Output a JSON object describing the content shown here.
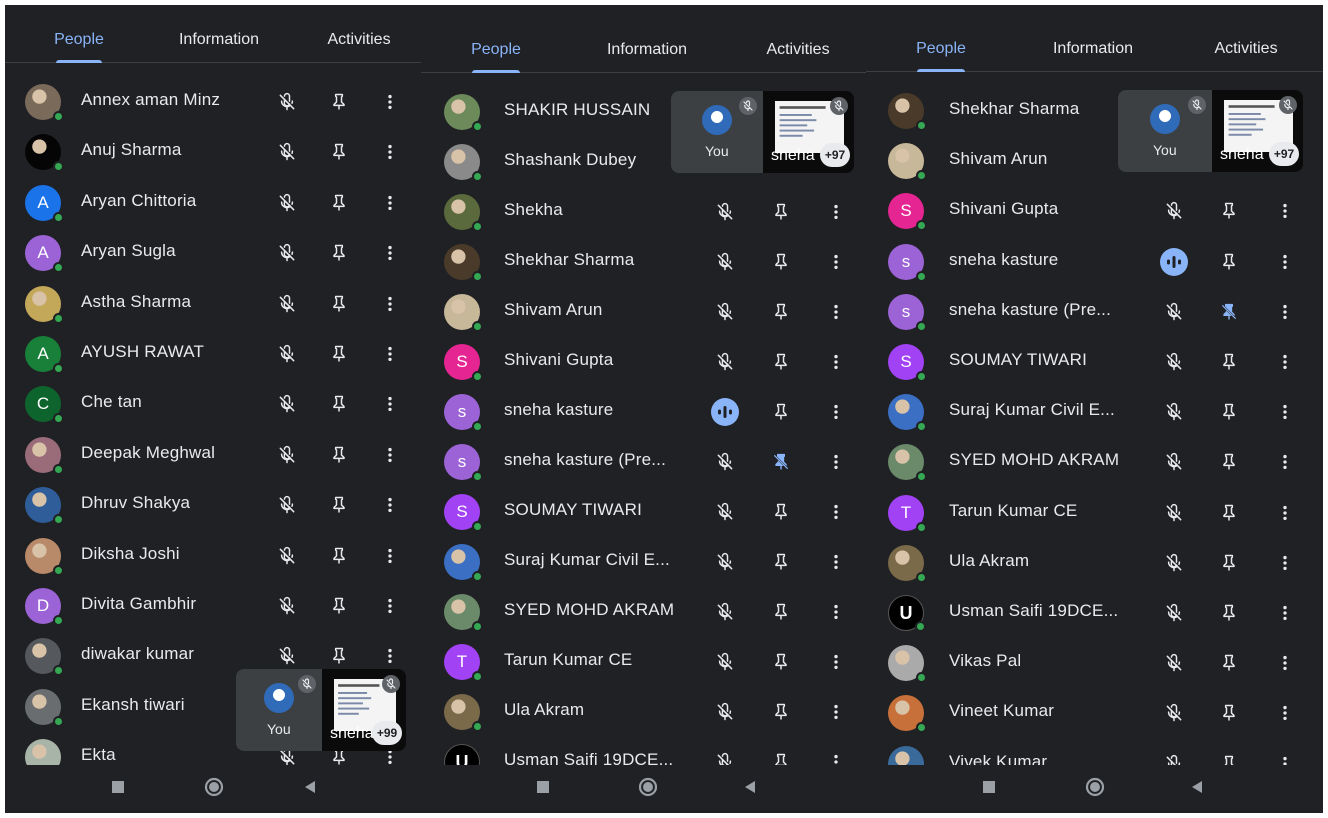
{
  "tabs": {
    "people": "People",
    "information": "Information",
    "activities": "Activities"
  },
  "pip": {
    "you_label": "You",
    "share_name": "sneha"
  },
  "colors": {
    "green_online": "#34a853",
    "accent": "#8ab4f8",
    "speaking": "#8ab4f8"
  },
  "panels": [
    {
      "pip_count": "+99",
      "rows": [
        {
          "name": "Annex aman Minz",
          "avatar": "photo",
          "color": "#7a6a5a"
        },
        {
          "name": "Anuj Sharma",
          "avatar": "photo",
          "color": "#050505"
        },
        {
          "name": "Aryan Chittoria",
          "avatar": "letter",
          "letter": "A",
          "color": "#1a73e8"
        },
        {
          "name": "Aryan Sugla",
          "avatar": "letter",
          "letter": "A",
          "color": "#9c63d6"
        },
        {
          "name": "Astha Sharma",
          "avatar": "photo",
          "color": "#c4a85a"
        },
        {
          "name": "AYUSH RAWAT",
          "avatar": "letter",
          "letter": "A",
          "color": "#188038"
        },
        {
          "name": "Che tan",
          "avatar": "letter",
          "letter": "C",
          "color": "#0d652d"
        },
        {
          "name": "Deepak Meghwal",
          "avatar": "photo",
          "color": "#9a6c7a"
        },
        {
          "name": "Dhruv Shakya",
          "avatar": "photo",
          "color": "#2f5d9a"
        },
        {
          "name": "Diksha Joshi",
          "avatar": "photo",
          "color": "#b88a6a"
        },
        {
          "name": "Divita Gambhir",
          "avatar": "letter",
          "letter": "D",
          "color": "#9c63d6"
        },
        {
          "name": "diwakar kumar",
          "avatar": "photo",
          "color": "#55585c"
        },
        {
          "name": "Ekansh tiwari",
          "avatar": "photo",
          "color": "#6a6d70"
        },
        {
          "name": "Ekta",
          "avatar": "photo",
          "color": "#a8b4a8"
        }
      ]
    },
    {
      "pip_count": "+97",
      "rows": [
        {
          "name": "SHAKIR HUSSAIN",
          "avatar": "photo",
          "color": "#6c8a5a"
        },
        {
          "name": "Shashank Dubey",
          "avatar": "photo",
          "color": "#8a8a8a"
        },
        {
          "name": "Shekha",
          "avatar": "photo",
          "color": "#5a6a3c"
        },
        {
          "name": "Shekhar Sharma",
          "avatar": "photo",
          "color": "#4a3a2a"
        },
        {
          "name": "Shivam Arun",
          "avatar": "photo",
          "color": "#c8b89a"
        },
        {
          "name": "Shivani Gupta",
          "avatar": "letter",
          "letter": "S",
          "color": "#e52592"
        },
        {
          "name": "sneha kasture",
          "avatar": "letter",
          "letter": "s",
          "color": "#9c63d6",
          "speaking": true
        },
        {
          "name": "sneha kasture (Pre...",
          "avatar": "letter",
          "letter": "s",
          "color": "#9c63d6",
          "pinned": true
        },
        {
          "name": "SOUMAY TIWARI",
          "avatar": "letter",
          "letter": "S",
          "color": "#a142f4"
        },
        {
          "name": "Suraj Kumar Civil E...",
          "avatar": "photo",
          "color": "#3b6fc4"
        },
        {
          "name": "SYED MOHD AKRAM",
          "avatar": "photo",
          "color": "#6a8a6a"
        },
        {
          "name": "Tarun Kumar CE",
          "avatar": "letter",
          "letter": "T",
          "color": "#a142f4"
        },
        {
          "name": "Ula Akram",
          "avatar": "photo",
          "color": "#7a6a4a"
        },
        {
          "name": "Usman Saifi 19DCE...",
          "avatar": "logo",
          "letter": "U",
          "color": "#000000"
        }
      ]
    },
    {
      "pip_count": "+97",
      "rows": [
        {
          "name": "Shekhar Sharma",
          "avatar": "photo",
          "color": "#4a3a2a"
        },
        {
          "name": "Shivam Arun",
          "avatar": "photo",
          "color": "#c8b89a"
        },
        {
          "name": "Shivani Gupta",
          "avatar": "letter",
          "letter": "S",
          "color": "#e52592"
        },
        {
          "name": "sneha kasture",
          "avatar": "letter",
          "letter": "s",
          "color": "#9c63d6",
          "speaking": true
        },
        {
          "name": "sneha kasture (Pre...",
          "avatar": "letter",
          "letter": "s",
          "color": "#9c63d6",
          "pinned": true
        },
        {
          "name": "SOUMAY TIWARI",
          "avatar": "letter",
          "letter": "S",
          "color": "#a142f4"
        },
        {
          "name": "Suraj Kumar Civil E...",
          "avatar": "photo",
          "color": "#3b6fc4"
        },
        {
          "name": "SYED MOHD AKRAM",
          "avatar": "photo",
          "color": "#6a8a6a"
        },
        {
          "name": "Tarun Kumar CE",
          "avatar": "letter",
          "letter": "T",
          "color": "#a142f4"
        },
        {
          "name": "Ula Akram",
          "avatar": "photo",
          "color": "#7a6a4a"
        },
        {
          "name": "Usman Saifi 19DCE...",
          "avatar": "logo",
          "letter": "U",
          "color": "#000000"
        },
        {
          "name": "Vikas Pal",
          "avatar": "photo",
          "color": "#aaaaaa"
        },
        {
          "name": "Vineet Kumar",
          "avatar": "photo",
          "color": "#c8703a"
        },
        {
          "name": "Vivek Kumar",
          "avatar": "photo",
          "color": "#3a6a9a"
        }
      ]
    }
  ]
}
